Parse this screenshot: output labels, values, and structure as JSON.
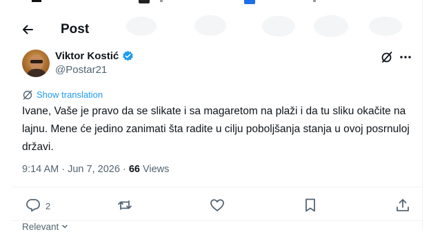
{
  "header": {
    "title": "Post",
    "back_icon": "arrow-left-icon"
  },
  "author": {
    "name": "Viktor Kostić",
    "handle": "@Postar21",
    "verified": true,
    "badge_color": "#1d9bf0"
  },
  "post": {
    "translate_label": "Show translation",
    "text": "Ivane, Vaše je pravo da se slikate i sa magaretom na plaži i da tu sliku okačite na lajnu. Mene će jedino zanimati šta radite u cilju poboljšanja stanja u ovoj posrnuloj državi.",
    "time": "9:14 AM",
    "separator": "·",
    "date": "Jun 7, 2026",
    "views_count": "66",
    "views_label": "Views"
  },
  "actions": {
    "reply_count": "2",
    "icons": [
      "reply-icon",
      "repost-icon",
      "like-icon",
      "bookmark-icon",
      "share-icon"
    ]
  },
  "footer": {
    "sort_label": "Relevant"
  },
  "colors": {
    "accent": "#1d9bf0",
    "muted": "#536471",
    "text": "#0f1419"
  }
}
